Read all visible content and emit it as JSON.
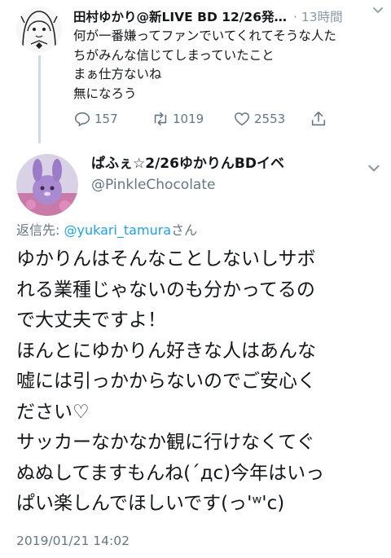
{
  "parent_tweet": {
    "display_name": "田村ゆかり@新LIVE BD 12/26発…",
    "time": "· 13時間",
    "text_lines": [
      "何が一番嫌ってファンでいてくれてそうな人た",
      "ちがみんな信じてしまっていたこと",
      "まぁ仕方ないね",
      "無になろう"
    ],
    "actions": {
      "replies": "157",
      "retweets": "1019",
      "likes": "2553"
    }
  },
  "main_tweet": {
    "display_name": "ぱふぇ☆2/26ゆかりんBDイベ",
    "handle": "@PinkleChocolate",
    "replying_prefix": "返信先: ",
    "replying_mention": "@yukari_tamura",
    "replying_suffix": "さん",
    "text_lines": [
      "ゆかりんはそんなことしないしサボ",
      "れる業種じゃないのも分かってるの",
      "で大丈夫ですよ！",
      "ほんとにゆかりん好きな人はあんな",
      "嘘には引っかからないのでご安心く",
      "ださい♡",
      "サッカーなかなか観に行けなくてぐ",
      "ぬぬしてますもんね(´дс)今年はいっ",
      "ぱい楽しんでほしいです(っ'ʷ'c)"
    ],
    "timestamp": "2019/01/21 14:02"
  },
  "colors": {
    "text": "#14171a",
    "secondary": "#657786",
    "link": "#1da1f2",
    "thread_line": "#cfd9de"
  }
}
